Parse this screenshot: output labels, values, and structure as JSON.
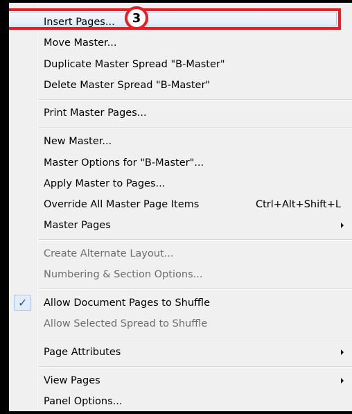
{
  "callout": {
    "number": "3"
  },
  "menu": {
    "items": [
      {
        "label": "Insert Pages...",
        "enabled": true
      },
      {
        "label": "Move Master...",
        "enabled": true
      },
      {
        "label": "Duplicate Master Spread \"B-Master\"",
        "enabled": true
      },
      {
        "label": "Delete Master Spread \"B-Master\"",
        "enabled": true
      },
      {
        "label": "Print Master Pages...",
        "enabled": true
      },
      {
        "label": "New Master...",
        "enabled": true
      },
      {
        "label": "Master Options for \"B-Master\"...",
        "enabled": true
      },
      {
        "label": "Apply Master to Pages...",
        "enabled": true
      },
      {
        "label": "Override All Master Page Items",
        "shortcut": "Ctrl+Alt+Shift+L",
        "enabled": true
      },
      {
        "label": "Master Pages",
        "submenu": true,
        "enabled": true
      },
      {
        "label": "Create Alternate Layout...",
        "enabled": false
      },
      {
        "label": "Numbering & Section Options...",
        "enabled": false
      },
      {
        "label": "Allow Document Pages to Shuffle",
        "checked": true,
        "check_glyph": "✓",
        "enabled": true
      },
      {
        "label": "Allow Selected Spread to Shuffle",
        "enabled": false
      },
      {
        "label": "Page Attributes",
        "submenu": true,
        "enabled": true
      },
      {
        "label": "View Pages",
        "submenu": true,
        "enabled": true
      },
      {
        "label": "Panel Options...",
        "enabled": true
      }
    ]
  },
  "colors": {
    "callout_red": "#ec1c24",
    "disabled_text": "#6d6d6d",
    "menu_bg": "#f0f0f0",
    "check_color": "#2a4fa0"
  }
}
